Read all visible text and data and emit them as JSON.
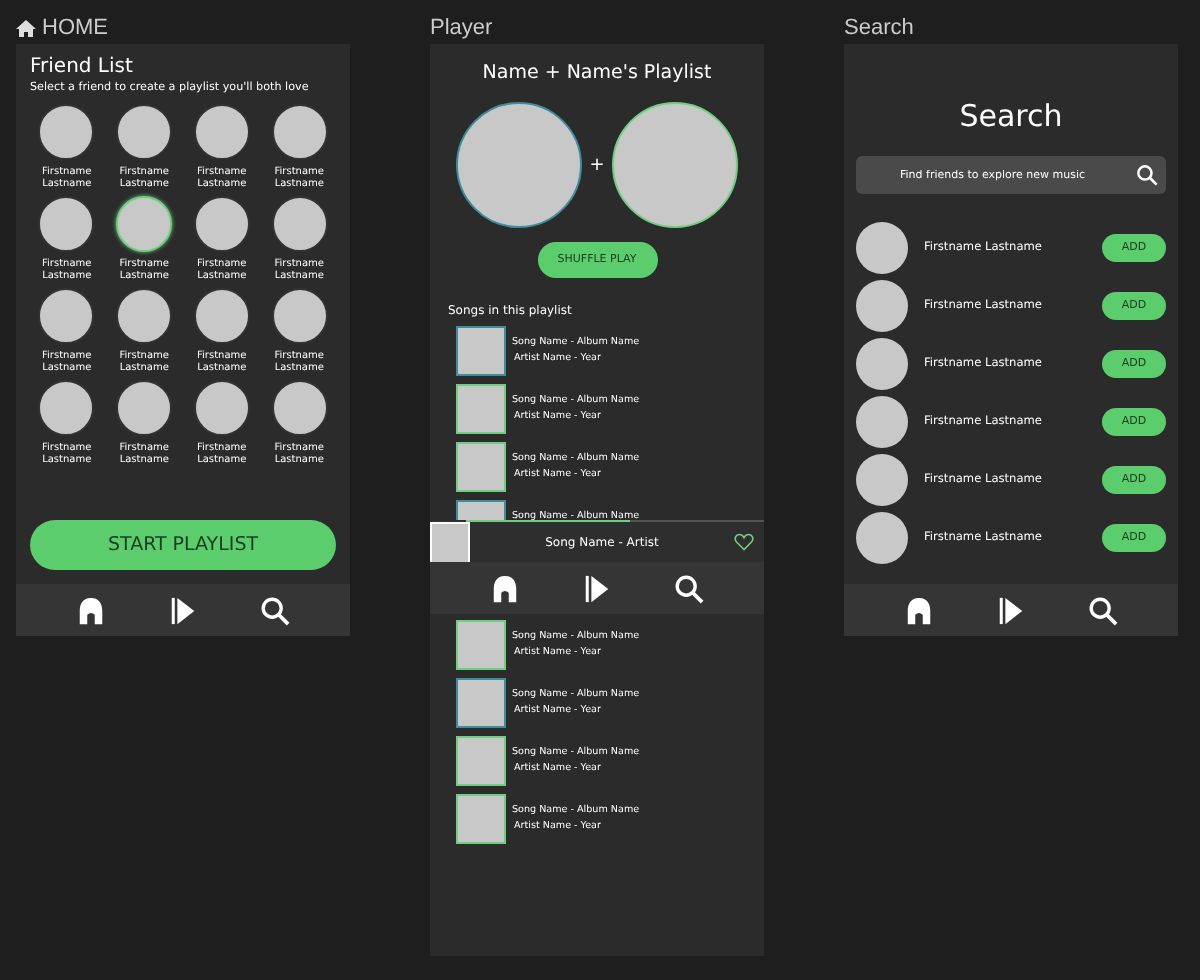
{
  "boards": {
    "home": "HOME",
    "player": "Player",
    "search": "Search"
  },
  "home": {
    "title": "Friend List",
    "subtitle": "Select a friend to create a playlist you'll both love",
    "friends": [
      {
        "first": "Firstname",
        "last": "Lastname",
        "selected": false
      },
      {
        "first": "Firstname",
        "last": "Lastname",
        "selected": false
      },
      {
        "first": "Firstname",
        "last": "Lastname",
        "selected": false
      },
      {
        "first": "Firstname",
        "last": "Lastname",
        "selected": false
      },
      {
        "first": "Firstname",
        "last": "Lastname",
        "selected": false
      },
      {
        "first": "Firstname",
        "last": "Lastname",
        "selected": true
      },
      {
        "first": "Firstname",
        "last": "Lastname",
        "selected": false
      },
      {
        "first": "Firstname",
        "last": "Lastname",
        "selected": false
      },
      {
        "first": "Firstname",
        "last": "Lastname",
        "selected": false
      },
      {
        "first": "Firstname",
        "last": "Lastname",
        "selected": false
      },
      {
        "first": "Firstname",
        "last": "Lastname",
        "selected": false
      },
      {
        "first": "Firstname",
        "last": "Lastname",
        "selected": false
      },
      {
        "first": "Firstname",
        "last": "Lastname",
        "selected": false
      },
      {
        "first": "Firstname",
        "last": "Lastname",
        "selected": false
      },
      {
        "first": "Firstname",
        "last": "Lastname",
        "selected": false
      },
      {
        "first": "Firstname",
        "last": "Lastname",
        "selected": false
      }
    ],
    "button": "START PLAYLIST"
  },
  "player": {
    "title": "Name + Name's Playlist",
    "avatars": [
      {
        "color": "#3f8d9c"
      },
      {
        "color": "#6fcf7f"
      }
    ],
    "plus": "+",
    "button": "SHUFFLE PLAY",
    "section": "Songs in this playlist",
    "songs_top": [
      {
        "title": "Song Name - Album Name",
        "meta": "Artist Name - Year",
        "color": "#3f8d9c"
      },
      {
        "title": "Song Name - Album Name",
        "meta": "Artist Name - Year",
        "color": "#6fcf7f"
      },
      {
        "title": "Song Name - Album Name",
        "meta": "Artist Name - Year",
        "color": "#6fcf7f"
      },
      {
        "title": "Song Name - Album Name",
        "color": "#3f8d9c"
      }
    ],
    "now_playing": {
      "title": "Song Name - Artist",
      "level": 0.55
    },
    "songs_bottom": [
      {
        "title": "Song Name - Album Name",
        "meta": "Artist Name - Year",
        "color": "#6fcf7f"
      },
      {
        "title": "Song Name - Album Name",
        "meta": "Artist Name - Year",
        "color": "#3f8d9c"
      },
      {
        "title": "Song Name - Album Name",
        "meta": "Artist Name - Year",
        "color": "#6fcf7f"
      },
      {
        "title": "Song Name - Album Name",
        "meta": "Artist Name - Year",
        "color": "#6fcf7f"
      }
    ]
  },
  "search": {
    "title": "Search",
    "placeholder": "Find friends to explore new music",
    "results": [
      {
        "name": "Firstname Lastname",
        "button": "ADD"
      },
      {
        "name": "Firstname Lastname",
        "button": "ADD"
      },
      {
        "name": "Firstname Lastname",
        "button": "ADD"
      },
      {
        "name": "Firstname Lastname",
        "button": "ADD"
      },
      {
        "name": "Firstname Lastname",
        "button": "ADD"
      },
      {
        "name": "Firstname Lastname",
        "button": "ADD"
      }
    ]
  }
}
